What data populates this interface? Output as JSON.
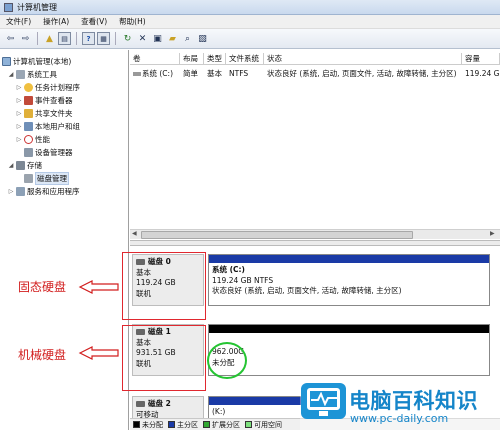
{
  "window": {
    "title": "计算机管理"
  },
  "menu": [
    "文件(F)",
    "操作(A)",
    "查看(V)",
    "帮助(H)"
  ],
  "toolbar": {
    "icons": [
      "back-arrow-icon",
      "forward-arrow-icon",
      "up-folder-icon",
      "show-hide-tree-icon",
      "help-icon",
      "properties-icon",
      "refresh-icon",
      "delete-icon",
      "disk-properties-icon",
      "open-folder-icon",
      "search-icon",
      "export-icon"
    ]
  },
  "tree": {
    "root": "计算机管理(本地)",
    "items": [
      {
        "label": "系统工具",
        "level": 1,
        "expanded": true
      },
      {
        "label": "任务计划程序",
        "level": 2
      },
      {
        "label": "事件查看器",
        "level": 2
      },
      {
        "label": "共享文件夹",
        "level": 2
      },
      {
        "label": "本地用户和组",
        "level": 2
      },
      {
        "label": "性能",
        "level": 2
      },
      {
        "label": "设备管理器",
        "level": 2
      },
      {
        "label": "存储",
        "level": 1,
        "expanded": true
      },
      {
        "label": "磁盘管理",
        "level": 2,
        "selected": true
      },
      {
        "label": "服务和应用程序",
        "level": 1
      }
    ]
  },
  "volume_table": {
    "columns": [
      "卷",
      "布局",
      "类型",
      "文件系统",
      "状态",
      "容量"
    ],
    "rows": [
      {
        "volume": "系统 (C:)",
        "layout": "简单",
        "type": "基本",
        "fs": "NTFS",
        "status": "状态良好 (系统, 启动, 页面文件, 活动, 故障转储, 主分区)",
        "capacity": "119.24 GB"
      }
    ]
  },
  "disks": [
    {
      "name": "磁盘 0",
      "type": "基本",
      "size": "119.24 GB",
      "state": "联机",
      "partition": {
        "title": "系统 (C:)",
        "size_fs": "119.24 GB NTFS",
        "status": "状态良好 (系统, 启动, 页面文件, 活动, 故障转储, 主分区)",
        "bar_color": "#1a3aa6"
      }
    },
    {
      "name": "磁盘 1",
      "type": "基本",
      "size": "931.51 GB",
      "state": "联机",
      "partition": {
        "title": "962.00G",
        "status": "未分配",
        "bar_color": "#000000"
      }
    },
    {
      "name": "磁盘 2",
      "type": "可移动",
      "partition": {
        "title": "(K:)"
      }
    }
  ],
  "legend": [
    {
      "label": "未分配",
      "color": "#000000"
    },
    {
      "label": "主分区",
      "color": "#1a3aa6"
    },
    {
      "label": "扩展分区",
      "color": "#33a833"
    },
    {
      "label": "可用空间",
      "color": "#7ee07e"
    }
  ],
  "annotations": {
    "ssd_label": "固态硬盘",
    "hdd_label": "机械硬盘",
    "colors": {
      "red": "#d21e1e",
      "green": "#25c432"
    }
  },
  "watermark": {
    "text": "电脑百科知识",
    "url": "www.pc-daily.com"
  }
}
